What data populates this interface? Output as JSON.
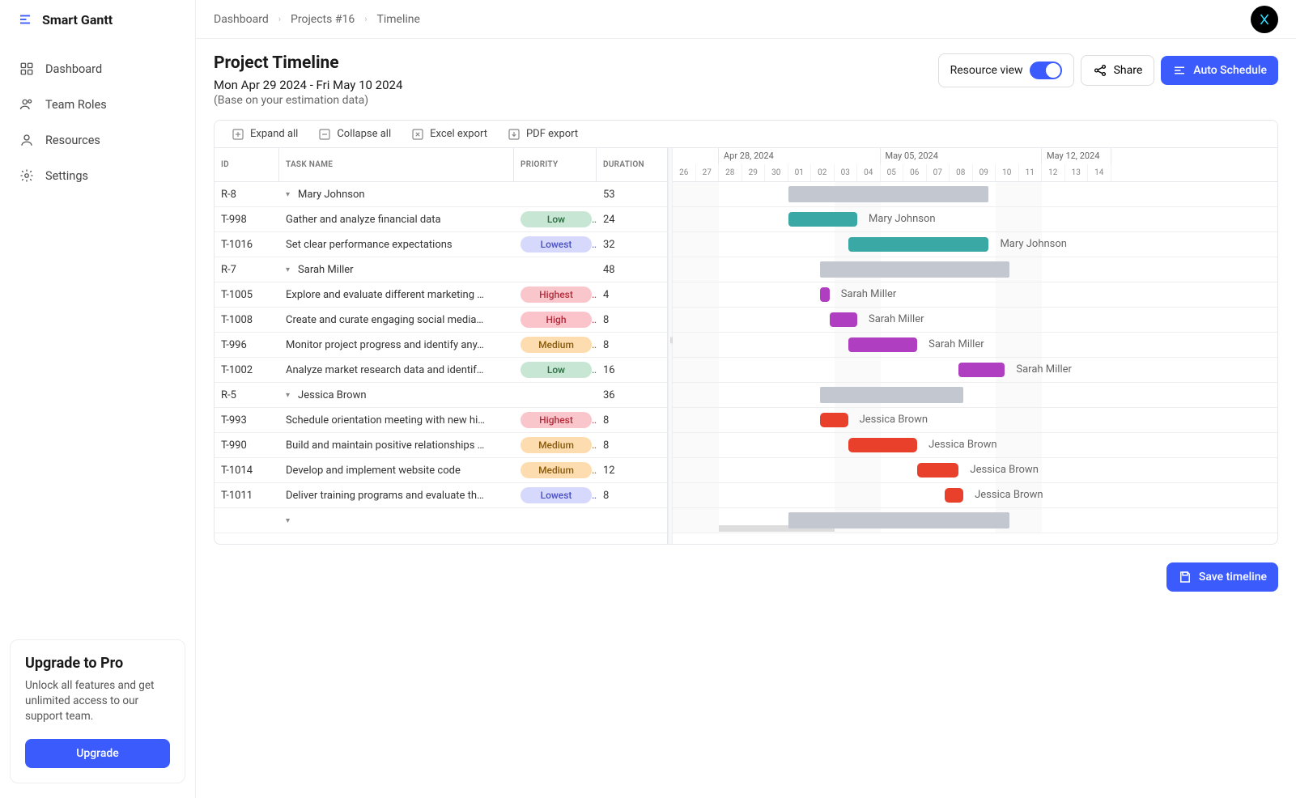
{
  "brand": "Smart Gantt",
  "nav": [
    {
      "label": "Dashboard"
    },
    {
      "label": "Team Roles"
    },
    {
      "label": "Resources"
    },
    {
      "label": "Settings"
    }
  ],
  "upgrade": {
    "title": "Upgrade to Pro",
    "text": "Unlock all features and get unlimited access to our support team.",
    "btn": "Upgrade"
  },
  "breadcrumb": [
    "Dashboard",
    "Projects #16",
    "Timeline"
  ],
  "header": {
    "title": "Project Timeline",
    "range": "Mon Apr 29 2024 - Fri May 10 2024",
    "note": "(Base on your estimation data)",
    "resource_view": "Resource view",
    "share": "Share",
    "auto": "Auto Schedule"
  },
  "toolbar": {
    "expand": "Expand all",
    "collapse": "Collapse all",
    "excel": "Excel export",
    "pdf": "PDF export"
  },
  "columns": {
    "id": "ID",
    "name": "TASK NAME",
    "priority": "PRIORITY",
    "duration": "DURATION"
  },
  "timeline": {
    "weeks": [
      {
        "label": "",
        "days": 2
      },
      {
        "label": "Apr 28, 2024",
        "days": 7
      },
      {
        "label": "May 05, 2024",
        "days": 7
      },
      {
        "label": "May 12, 2024",
        "days": 3
      }
    ],
    "days": [
      "26",
      "27",
      "28",
      "29",
      "30",
      "01",
      "02",
      "03",
      "04",
      "05",
      "06",
      "07",
      "08",
      "09",
      "10",
      "11",
      "12",
      "13",
      "14"
    ],
    "weekends": [
      0,
      1,
      7,
      8,
      14,
      15
    ]
  },
  "rows": [
    {
      "id": "R-8",
      "name": "Mary Johnson",
      "group": true,
      "dur": "53",
      "start": 5,
      "len": 8.7,
      "color": "group"
    },
    {
      "id": "T-998",
      "name": "Gather and analyze financial data",
      "pri": "Low",
      "dur": "24",
      "start": 5,
      "len": 3,
      "color": "teal",
      "who": "Mary Johnson"
    },
    {
      "id": "T-1016",
      "name": "Set clear performance expectations",
      "pri": "Lowest",
      "dur": "32",
      "start": 7.6,
      "len": 6.1,
      "color": "teal",
      "who": "Mary Johnson"
    },
    {
      "id": "R-7",
      "name": "Sarah Miller",
      "group": true,
      "dur": "48",
      "start": 6.4,
      "len": 8.2,
      "color": "group"
    },
    {
      "id": "T-1005",
      "name": "Explore and evaluate different marketing …",
      "pri": "Highest",
      "dur": "4",
      "start": 6.4,
      "len": 0.4,
      "color": "purple",
      "who": "Sarah Miller"
    },
    {
      "id": "T-1008",
      "name": "Create and curate engaging social media…",
      "pri": "High",
      "dur": "8",
      "start": 6.8,
      "len": 1.2,
      "color": "purple",
      "who": "Sarah Miller"
    },
    {
      "id": "T-996",
      "name": "Monitor project progress and identify any…",
      "pri": "Medium",
      "dur": "8",
      "start": 7.6,
      "len": 3,
      "color": "purple",
      "who": "Sarah Miller"
    },
    {
      "id": "T-1002",
      "name": "Analyze market research data and identif…",
      "pri": "Low",
      "dur": "16",
      "start": 12.4,
      "len": 2,
      "color": "purple",
      "who": "Sarah Miller"
    },
    {
      "id": "R-5",
      "name": "Jessica Brown",
      "group": true,
      "dur": "36",
      "start": 6.4,
      "len": 6.2,
      "color": "group"
    },
    {
      "id": "T-993",
      "name": "Schedule orientation meeting with new hi…",
      "pri": "Highest",
      "dur": "8",
      "start": 6.4,
      "len": 1.2,
      "color": "red",
      "who": "Jessica Brown"
    },
    {
      "id": "T-990",
      "name": "Build and maintain positive relationships …",
      "pri": "Medium",
      "dur": "8",
      "start": 7.6,
      "len": 3,
      "color": "red",
      "who": "Jessica Brown"
    },
    {
      "id": "T-1014",
      "name": "Develop and implement website code",
      "pri": "Medium",
      "dur": "12",
      "start": 10.6,
      "len": 1.8,
      "color": "red",
      "who": "Jessica Brown"
    },
    {
      "id": "T-1011",
      "name": "Deliver training programs and evaluate th…",
      "pri": "Lowest",
      "dur": "8",
      "start": 11.8,
      "len": 0.8,
      "color": "red",
      "who": "Jessica Brown"
    },
    {
      "id": "",
      "name": "",
      "group": true,
      "dur": "",
      "start": 5,
      "len": 9.6,
      "color": "group"
    }
  ],
  "save_btn": "Save timeline"
}
